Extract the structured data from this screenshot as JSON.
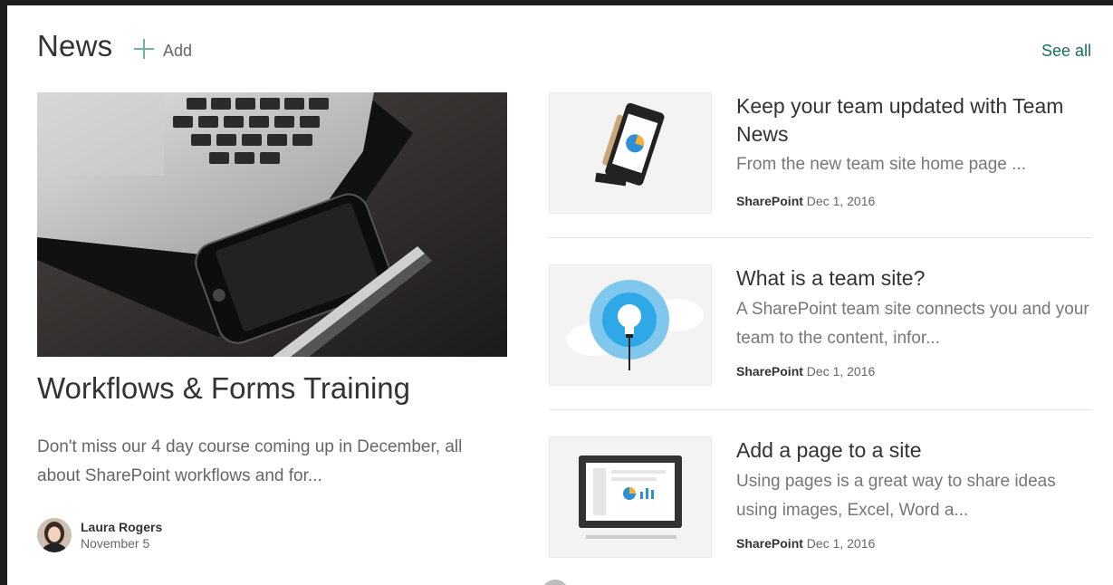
{
  "section": {
    "title": "News",
    "add_label": "Add",
    "see_all_label": "See all"
  },
  "hero": {
    "title": "Workflows & Forms Training",
    "description": "Don't miss our 4 day course coming up in December, all about SharePoint workflows and for...",
    "author": "Laura Rogers",
    "date": "November 5"
  },
  "news_items": [
    {
      "title": "Keep your team updated with Team News",
      "description": "From the new team site home page ...",
      "source": "SharePoint",
      "date": "Dec 1, 2016",
      "thumbnail_icon": "phone-chart-icon"
    },
    {
      "title": "What is a team site?",
      "description": "A SharePoint team site connects you and your team to the content, infor...",
      "source": "SharePoint",
      "date": "Dec 1, 2016",
      "thumbnail_icon": "lightbulb-cloud-icon"
    },
    {
      "title": "Add a page to a site",
      "description": "Using pages is a great way to share ideas using images, Excel, Word a...",
      "source": "SharePoint",
      "date": "Dec 1, 2016",
      "thumbnail_icon": "monitor-chart-icon"
    }
  ],
  "colors": {
    "accent": "#6fb3a6",
    "link": "#1b6b5e",
    "text": "#333333",
    "muted": "#666666"
  }
}
